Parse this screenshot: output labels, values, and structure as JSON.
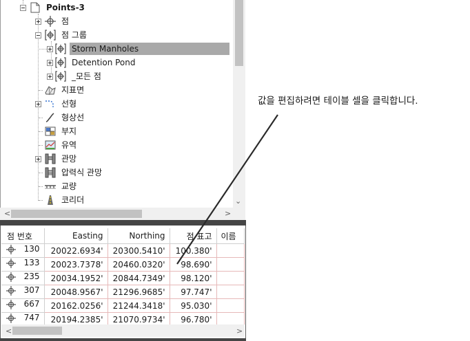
{
  "tree": {
    "items": [
      {
        "label": "Points-3",
        "icon": "document-icon",
        "bold": true
      },
      {
        "label": "점",
        "icon": "point-icon"
      },
      {
        "label": "점 그룹",
        "icon": "point-group-icon"
      },
      {
        "label": "Storm Manholes",
        "icon": "point-group-icon",
        "selected": true
      },
      {
        "label": "Detention Pond",
        "icon": "point-group-icon"
      },
      {
        "label": "_모든 점",
        "icon": "point-group-icon"
      },
      {
        "label": "지표면",
        "icon": "surface-icon"
      },
      {
        "label": "선형",
        "icon": "alignment-icon"
      },
      {
        "label": "형상선",
        "icon": "feature-line-icon"
      },
      {
        "label": "부지",
        "icon": "site-icon"
      },
      {
        "label": "유역",
        "icon": "catchment-icon"
      },
      {
        "label": "관망",
        "icon": "pipe-network-icon"
      },
      {
        "label": "압력식 관망",
        "icon": "pressure-network-icon"
      },
      {
        "label": "교량",
        "icon": "bridge-icon"
      },
      {
        "label": "코리더",
        "icon": "corridor-icon"
      }
    ]
  },
  "grid": {
    "columns": [
      "점 번호",
      "Easting",
      "Northing",
      "점 표고",
      "이름"
    ],
    "rows": [
      {
        "number": "130",
        "easting": "20022.6934'",
        "northing": "20300.5410'",
        "elevation": "100.380'",
        "name": ""
      },
      {
        "number": "133",
        "easting": "20023.7378'",
        "northing": "20460.0320'",
        "elevation": "98.690'",
        "name": ""
      },
      {
        "number": "235",
        "easting": "20034.1952'",
        "northing": "20844.7349'",
        "elevation": "98.120'",
        "name": ""
      },
      {
        "number": "307",
        "easting": "20048.9567'",
        "northing": "21296.9685'",
        "elevation": "97.747'",
        "name": ""
      },
      {
        "number": "667",
        "easting": "20162.0256'",
        "northing": "21244.3418'",
        "elevation": "95.030'",
        "name": ""
      },
      {
        "number": "747",
        "easting": "20194.2385'",
        "northing": "21070.9734'",
        "elevation": "96.780'",
        "name": ""
      }
    ]
  },
  "callout": {
    "text": "값을 편집하려면 테이블 셀을 클릭합니다."
  },
  "scroll_glyphs": {
    "left": "<",
    "right": ">",
    "down": "⌄"
  },
  "colors": {
    "selection": "#a9a9a9",
    "divider": "#454545",
    "grid_line": "#e6b8b8"
  }
}
